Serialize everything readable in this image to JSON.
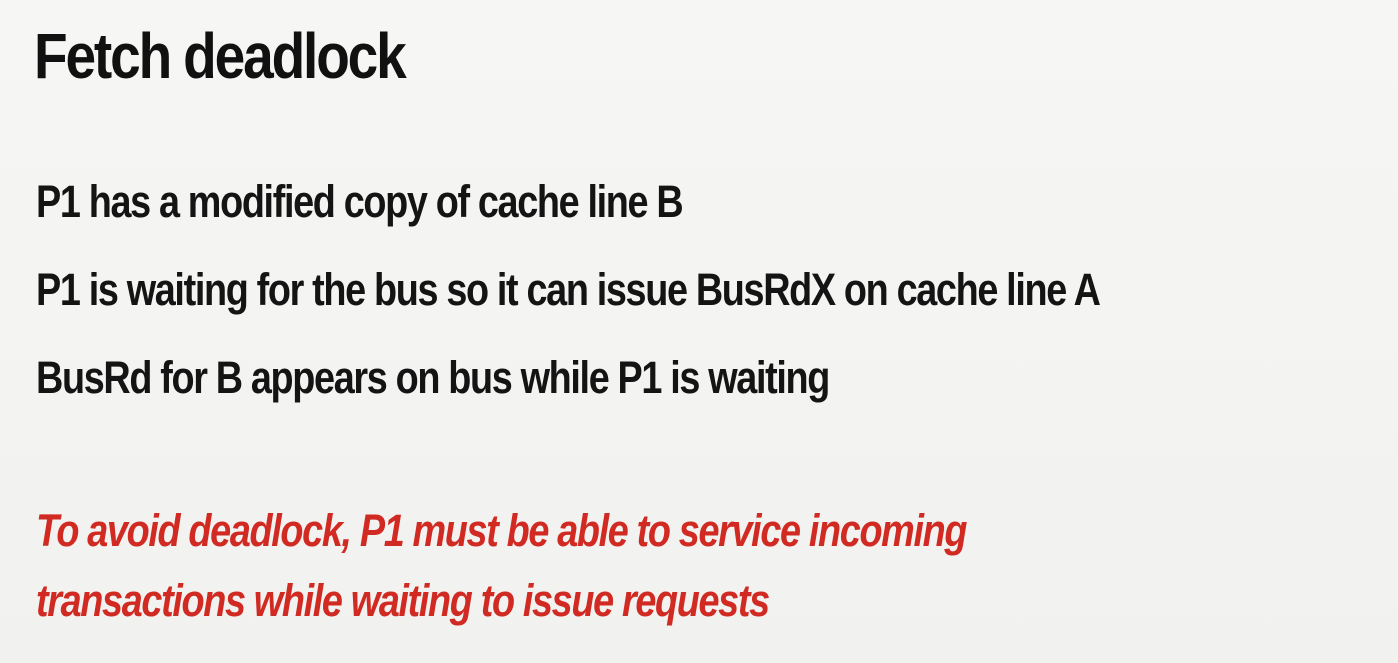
{
  "slide": {
    "title": "Fetch deadlock",
    "bullets": [
      "P1 has a modified copy of cache line B",
      "P1 is waiting for the bus so it can issue BusRdX on cache line A",
      "BusRd for B appears on bus while P1 is waiting"
    ],
    "note_lines": [
      "To avoid deadlock, P1 must be able to service incoming",
      "transactions while waiting to issue requests"
    ]
  },
  "colors": {
    "background": "#f4f4f2",
    "text": "#141414",
    "accent": "#d12a22"
  }
}
